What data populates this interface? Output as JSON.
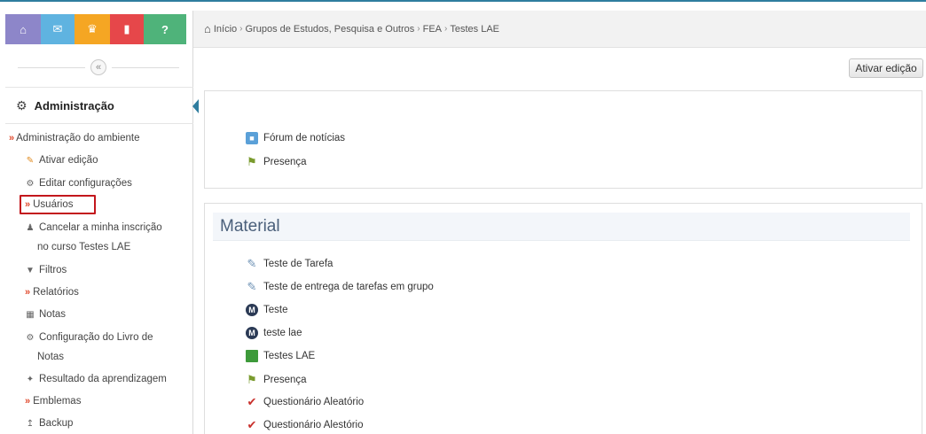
{
  "breadcrumb": [
    "Início",
    "Grupos de Estudos, Pesquisa e Outros",
    "FEA",
    "Testes LAE"
  ],
  "quickbar_icons": [
    "home-icon",
    "mail-icon",
    "group-icon",
    "document-icon",
    "help-icon"
  ],
  "collapse_glyph": "«",
  "admin": {
    "title": "Administração",
    "items": {
      "admin_ambiente": "Administração do ambiente",
      "ativar_edicao": "Ativar edição",
      "editar_config": "Editar configurações",
      "usuarios": "Usuários",
      "cancelar_1": "Cancelar a minha inscrição",
      "cancelar_2": "no curso Testes LAE",
      "filtros": "Filtros",
      "relatorios": "Relatórios",
      "notas": "Notas",
      "config_livro_1": "Configuração do Livro de",
      "config_livro_2": "Notas",
      "resultado": "Resultado da aprendizagem",
      "emblemas": "Emblemas",
      "backup": "Backup"
    }
  },
  "edit_button": "Ativar edição",
  "section0": {
    "activities": [
      "Fórum de notícias",
      "Presença"
    ]
  },
  "section1": {
    "title": "Material",
    "activities": [
      "Teste de Tarefa",
      "Teste de entrega de tarefas em grupo",
      "Teste",
      "teste lae",
      "Testes LAE",
      "Presença",
      "Questionário Aleatório",
      "Questionário Alestório"
    ]
  },
  "colors": {
    "accent": "#2f7d9f",
    "highlight": "#c3161c",
    "chevron": "#e0482b"
  }
}
